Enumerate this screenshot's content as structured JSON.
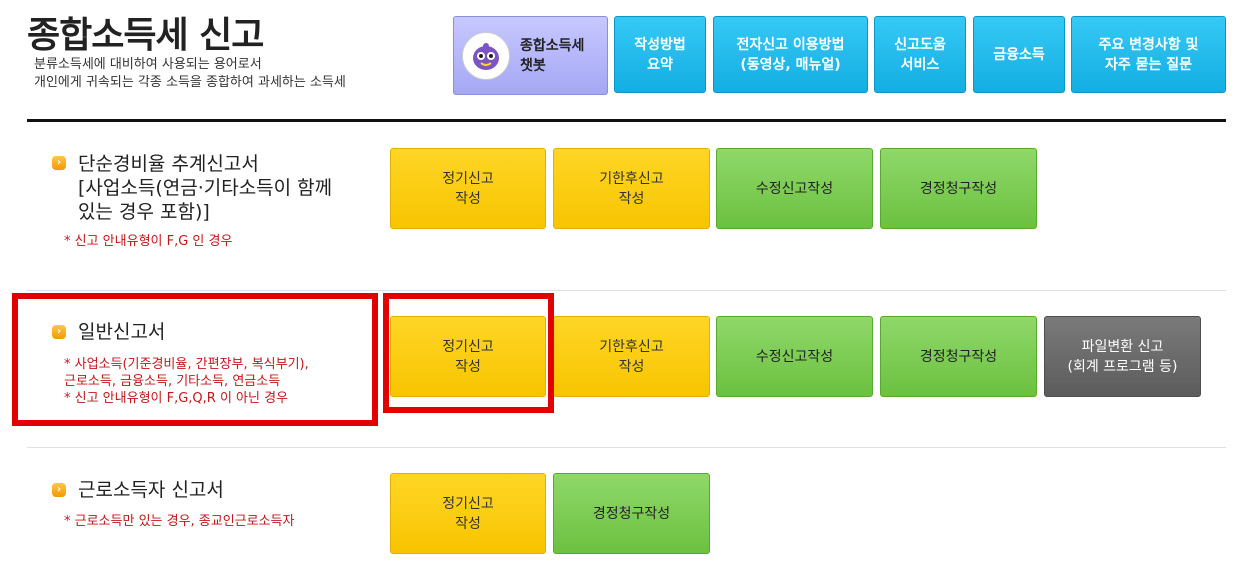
{
  "header": {
    "title": "종합소득세 신고",
    "desc_line1": "분류소득세에 대비하여 사용되는 용어로서",
    "desc_line2": "개인에게 귀속되는 각종 소득을 종합하여 과세하는 소득세"
  },
  "top_buttons": {
    "chatbot": "종합소득세\n챗봇",
    "how_to_write": "작성방법\n요약",
    "e_filing_guide": "전자신고 이용방법\n(동영상, 매뉴얼)",
    "filing_help": "신고도움\n서비스",
    "financial_income": "금융소득",
    "changes_faq": "주요 변경사항 및\n자주 묻는 질문"
  },
  "sections": {
    "simple": {
      "title": "단순경비율 추계신고서\n[사업소득(연금·기타소득이 함께\n있는 경우 포함)]",
      "note": "* 신고 안내유형이 F,G 인 경우",
      "btn_regular": "정기신고\n작성",
      "btn_late": "기한후신고\n작성",
      "btn_amend": "수정신고작성",
      "btn_refund": "경정청구작성"
    },
    "general": {
      "title": "일반신고서",
      "note": "* 사업소득(기준경비율, 간편장부, 복식부기),\n  근로소득, 금융소득, 기타소득, 연금소득\n* 신고 안내유형이 F,G,Q,R 이 아닌 경우",
      "btn_regular": "정기신고\n작성",
      "btn_late": "기한후신고\n작성",
      "btn_amend": "수정신고작성",
      "btn_refund": "경정청구작성",
      "btn_file_convert": "파일변환 신고\n(회계 프로그램 등)"
    },
    "earned": {
      "title": "근로소득자 신고서",
      "note": "* 근로소득만 있는 경우, 종교인근로소득자",
      "btn_regular": "정기신고\n작성",
      "btn_refund": "경정청구작성"
    }
  },
  "icons": {
    "section_bullet": "arrow-right-icon",
    "chatbot": "chatbot-icon"
  },
  "colors": {
    "highlight": "#e30000",
    "yellow_button": "#f7c400",
    "green_button": "#6cc140",
    "gray_button": "#5c5c5c",
    "top_button": "#14aee3",
    "note_text": "#c4161c"
  }
}
